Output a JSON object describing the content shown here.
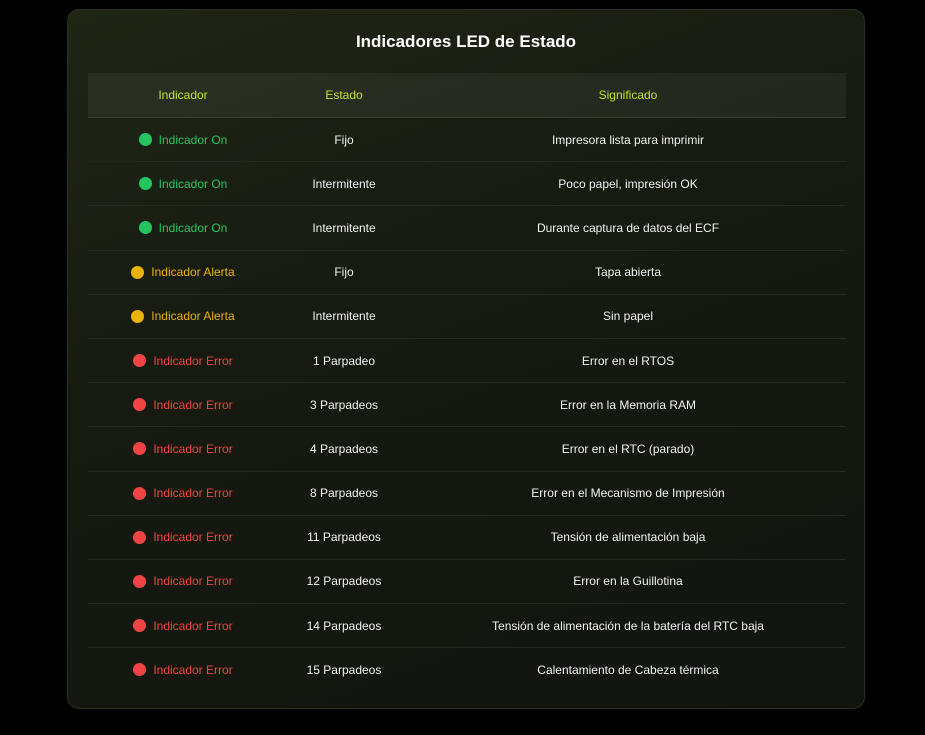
{
  "title": "Indicadores LED de Estado",
  "headers": {
    "indicator": "Indicador",
    "state": "Estado",
    "meaning": "Significado"
  },
  "colors": {
    "green": "#22c55e",
    "yellow": "#eab308",
    "red": "#ef4444",
    "header_text": "#c8e02a"
  },
  "rows": [
    {
      "indicator": "Indicador On",
      "status": "green",
      "state": "Fijo",
      "meaning": "Impresora lista para imprimir"
    },
    {
      "indicator": "Indicador On",
      "status": "green",
      "state": "Intermitente",
      "meaning": "Poco papel, impresión OK"
    },
    {
      "indicator": "Indicador On",
      "status": "green",
      "state": "Intermitente",
      "meaning": "Durante captura de datos del ECF"
    },
    {
      "indicator": "Indicador Alerta",
      "status": "yellow",
      "state": "Fijo",
      "meaning": "Tapa abierta"
    },
    {
      "indicator": "Indicador Alerta",
      "status": "yellow",
      "state": "Intermitente",
      "meaning": "Sin papel"
    },
    {
      "indicator": "Indicador Error",
      "status": "red",
      "state": "1 Parpadeo",
      "meaning": "Error en el RTOS"
    },
    {
      "indicator": "Indicador Error",
      "status": "red",
      "state": "3 Parpadeos",
      "meaning": "Error en la Memoria RAM"
    },
    {
      "indicator": "Indicador Error",
      "status": "red",
      "state": "4 Parpadeos",
      "meaning": "Error en el RTC (parado)"
    },
    {
      "indicator": "Indicador Error",
      "status": "red",
      "state": "8 Parpadeos",
      "meaning": "Error en el Mecanismo de Impresión"
    },
    {
      "indicator": "Indicador Error",
      "status": "red",
      "state": "11 Parpadeos",
      "meaning": "Tensión de alimentación baja"
    },
    {
      "indicator": "Indicador Error",
      "status": "red",
      "state": "12 Parpadeos",
      "meaning": "Error en la Guillotina"
    },
    {
      "indicator": "Indicador Error",
      "status": "red",
      "state": "14 Parpadeos",
      "meaning": "Tensión de alimentación de la batería del RTC baja"
    },
    {
      "indicator": "Indicador Error",
      "status": "red",
      "state": "15 Parpadeos",
      "meaning": "Calentamiento de Cabeza térmica"
    }
  ]
}
